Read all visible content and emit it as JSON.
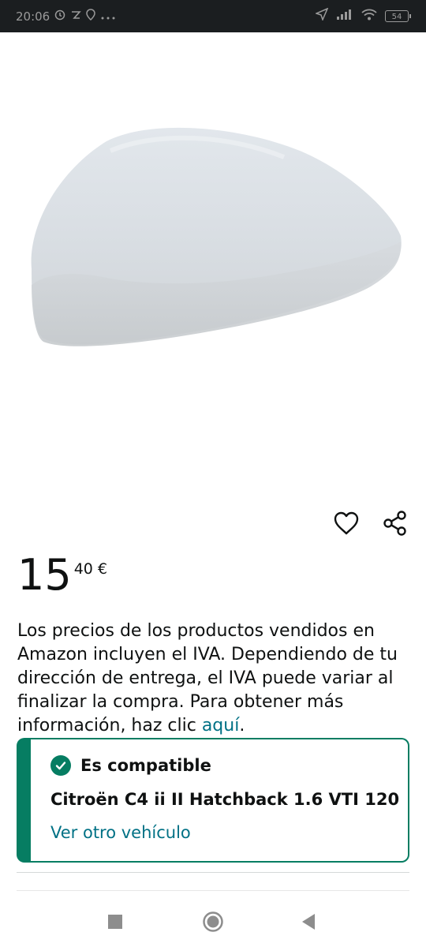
{
  "status_bar": {
    "time": "20:06",
    "battery": "54",
    "icons": [
      "alarm-icon",
      "sync-icon",
      "location-icon",
      "more-dots-icon",
      "navigation-arrow-icon",
      "signal-icon",
      "wifi-icon",
      "battery-icon"
    ]
  },
  "product": {
    "image_alt": "mirror-cover-image",
    "wishlist_icon": "heart-icon",
    "share_icon": "share-icon"
  },
  "price": {
    "whole": "15",
    "fraction": "40",
    "currency": "€"
  },
  "vat_note": {
    "text": "Los precios de los productos vendidos en Amazon incluyen el IVA. Dependiendo de tu dirección de entrega, el IVA puede variar al finalizar la compra. Para obtener más información, haz clic ",
    "link": "aquí",
    "end": "."
  },
  "compatibility": {
    "title": "Es compatible",
    "vehicle": "Citroën C4 ii II Hatchback 1.6 VTI 120",
    "change_link": "Ver otro vehículo"
  },
  "nav_bar": {
    "icons": [
      "recents-square-icon",
      "home-circle-icon",
      "back-triangle-icon"
    ]
  },
  "colors": {
    "accent": "#067d62",
    "link": "#007185",
    "text": "#0f1111"
  }
}
